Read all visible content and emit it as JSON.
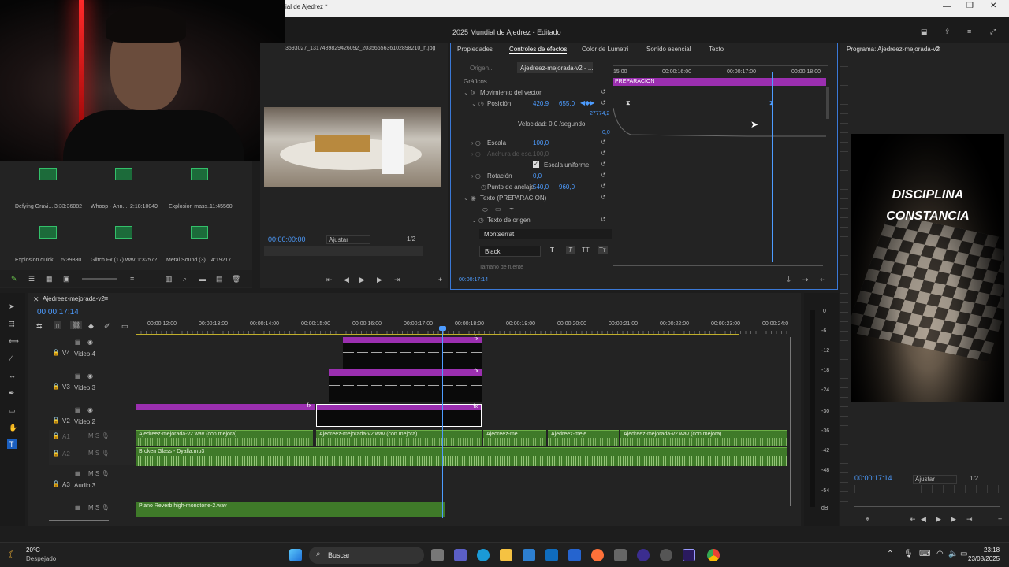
{
  "window": {
    "title": "ial de Ajedrez *"
  },
  "app": {
    "project_title": "2025 Mundial de Ajedrez - Editado"
  },
  "source_panel": {
    "clip_name": "3593027_1317489829426092_2035665636102898210_n.jpg",
    "timecode": "00:00:00:00",
    "fit": "Ajustar",
    "ratio": "1/2"
  },
  "bins": [
    {
      "name": "Defying Gravi...",
      "duration": "3:33:36082"
    },
    {
      "name": "Whoop - Ann...",
      "duration": "2:18:10049"
    },
    {
      "name": "Explosion mass...",
      "duration": "11:45560"
    },
    {
      "name": "Explosion quick...",
      "duration": "5:39880"
    },
    {
      "name": "Glitch Fx (17).wav",
      "duration": "1:32572"
    },
    {
      "name": "Metal Sound (3)...",
      "duration": "4:19217"
    }
  ],
  "effects_panel": {
    "tabs": [
      "Propiedades",
      "Controles de efectos",
      "Color de Lumetri",
      "Sonido esencial",
      "Texto"
    ],
    "active_tab": "Controles de efectos",
    "source": "Origen...",
    "sequence": "Ajedreez-mejorada-v2 - ...",
    "section": "Gráficos",
    "ruler": [
      "15:00",
      "00:00:16:00",
      "00:00:17:00",
      "00:00:18:00"
    ],
    "clip_label": "PREPARACION",
    "rows": [
      {
        "label": "Movimiento del vector"
      },
      {
        "label": "Posición",
        "v1": "420,9",
        "v2": "655,0"
      },
      {
        "label": "Velocidad: 0,0 /segundo",
        "v1": "27774,2",
        "v2": "0,0"
      },
      {
        "label": "Escala",
        "v1": "100,0"
      },
      {
        "label": "Anchura de esc...",
        "v1": "100,0"
      },
      {
        "label": "Escala uniforme"
      },
      {
        "label": "Rotación",
        "v1": "0,0"
      },
      {
        "label": "Punto de anclaje",
        "v1": "540,0",
        "v2": "960,0"
      },
      {
        "label": "Texto (PREPARACION)"
      },
      {
        "label": "Texto de origen"
      }
    ],
    "font": "Montserrat",
    "weight": "Black",
    "more": "Tamaño de fuente",
    "timecode": "00:00:17:14"
  },
  "program": {
    "title": "Programa: Ajedreez-mejorada-v2",
    "line1": "DISCIPLINA",
    "line2": "CONSTANCIA",
    "timecode": "00:00:17:14",
    "fit": "Ajustar",
    "ratio": "1/2"
  },
  "timeline": {
    "sequence": "Ajedreez-mejorada-v2",
    "timecode": "00:00:17:14",
    "ruler": [
      "00:00:12:00",
      "00:00:13:00",
      "00:00:14:00",
      "00:00:15:00",
      "00:00:16:00",
      "00:00:17:00",
      "00:00:18:00",
      "00:00:19:00",
      "00:00:20:00",
      "00:00:21:00",
      "00:00:22:00",
      "00:00:23:00",
      "00:00:24:0"
    ],
    "tracks": [
      {
        "id": "V4",
        "name": "Video 4"
      },
      {
        "id": "V3",
        "name": "Video 3"
      },
      {
        "id": "V2",
        "name": "Video 2"
      },
      {
        "id": "A1",
        "name": ""
      },
      {
        "id": "A2",
        "name": ""
      },
      {
        "id": "A3",
        "name": "Audio 3"
      },
      {
        "id": "",
        "name": ""
      }
    ],
    "audio_clips": {
      "a1_1": "Ajedreez-mejorada-v2.wav (con mejora)",
      "a1_2": "Ajedreez-mejorada-v2.wav (con mejora)",
      "a1_3": "Ajedreez-me...",
      "a1_4": "Ajedreez-meje...",
      "a1_5": "Ajedreez-mejorada-v2.wav (con mejora)",
      "a2": "Broken Glass - Dyalla.mp3",
      "a4": "Piano Reverb high-monotone-2.wav"
    },
    "meter": [
      "0",
      "-6",
      "-12",
      "-18",
      "-24",
      "-30",
      "-36",
      "-42",
      "-48",
      "-54",
      "dB"
    ]
  },
  "taskbar": {
    "weather_temp": "20°C",
    "weather_desc": "Despejado",
    "search": "Buscar",
    "time": "23:18",
    "date": "23/08/2025"
  }
}
